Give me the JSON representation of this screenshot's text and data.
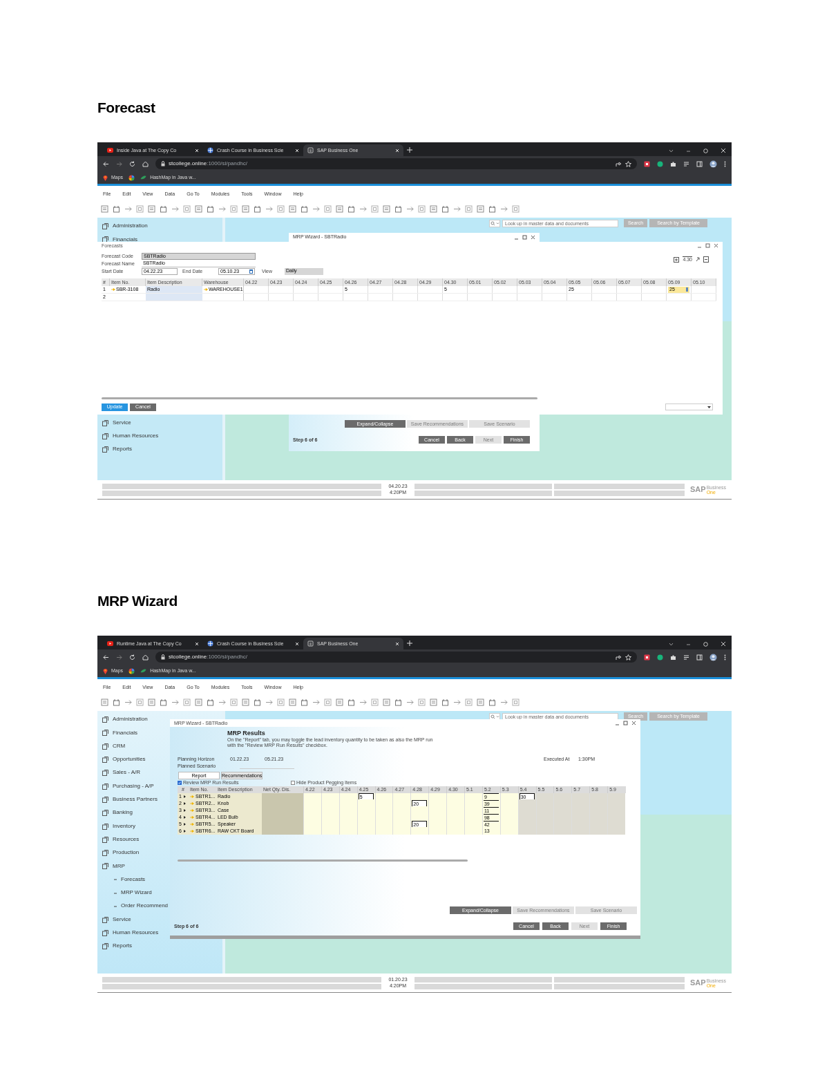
{
  "sections": [
    {
      "heading": "Forecast",
      "kind": "forecast",
      "browser": {
        "tabs": [
          {
            "title": "Inside Java at The Copy Co",
            "selected": false
          },
          {
            "title": "Crash Course in Business Scie",
            "selected": false
          },
          {
            "title": "SAP Business One",
            "selected": true
          }
        ],
        "url_host": "stcollege.online",
        "url_path": ":1000/sl/pandhc/",
        "bookmarks": [
          "Maps",
          "HashMap in Java w..."
        ]
      },
      "menu": [
        "File",
        "Edit",
        "View",
        "Data",
        "Go To",
        "Modules",
        "Tools",
        "Window",
        "Help"
      ],
      "search": {
        "placeholder": "Look up in master data and documents",
        "buttons": [
          "Search",
          "Search by Template"
        ]
      },
      "sidebar_top": [
        {
          "label": "Administration"
        },
        {
          "label": "Financials"
        }
      ],
      "sidebar_bottom": [
        {
          "label": "Service"
        },
        {
          "label": "Human Resources"
        },
        {
          "label": "Reports"
        }
      ],
      "wizard": {
        "title": "MRP Wizard - SBTRadio",
        "top_buttons": [
          {
            "label": "Expand/Collapse",
            "disabled": false
          },
          {
            "label": "Save Recommendations",
            "disabled": true
          },
          {
            "label": "Save Scenario",
            "disabled": true
          }
        ],
        "step": "Step 6 of 6",
        "buttons": [
          {
            "label": "Cancel",
            "disabled": false
          },
          {
            "label": "Back",
            "disabled": false
          },
          {
            "label": "Next",
            "disabled": true
          },
          {
            "label": "Finish",
            "disabled": false
          }
        ]
      },
      "forecast_window": {
        "title": "Forecasts",
        "fields": [
          {
            "label": "Forecast Code",
            "value": "SBTRadio"
          },
          {
            "label": "Forecast Name",
            "value": "SBTRadio"
          }
        ],
        "start_label": "Start Date",
        "start": "04.22.23",
        "end_label": "End Date",
        "end": "05.10.23",
        "view_label": "View",
        "view": "Daily",
        "zoom": "4.30",
        "columns": [
          "#",
          "Item No.",
          "Item Description",
          "Warehouse"
        ],
        "date_columns": [
          "04.22",
          "04.23",
          "04.24",
          "04.25",
          "04.26",
          "04.27",
          "04.28",
          "04.29",
          "04.30",
          "05.01",
          "05.02",
          "05.03",
          "05.04",
          "05.05",
          "05.06",
          "05.07",
          "05.08",
          "05.09",
          "05.10"
        ],
        "rows": [
          {
            "num": "1",
            "item_no": "SBR-3108",
            "description": "Radio",
            "warehouse": "WAREHOUSE1",
            "cells": [
              null,
              null,
              null,
              null,
              {
                "text": "5",
                "selected": false
              },
              null,
              null,
              null,
              {
                "text": "5",
                "selected": false
              },
              null,
              null,
              null,
              null,
              {
                "text": "25",
                "selected": false
              },
              null,
              null,
              null,
              {
                "text": "25",
                "selected": true
              },
              null
            ]
          },
          {
            "num": "2"
          }
        ],
        "buttons": [
          "Update",
          "Cancel"
        ]
      },
      "status_bar": {
        "date": "04.20.23",
        "time": "4:20PM"
      },
      "logo": {
        "brand": "SAP",
        "line1": "Business",
        "line2": "One"
      }
    },
    {
      "heading": "MRP Wizard",
      "kind": "wizard",
      "browser": {
        "tabs": [
          {
            "title": "Runtime Java at The Copy Co",
            "selected": false
          },
          {
            "title": "Crash Course in Business Scie",
            "selected": false
          },
          {
            "title": "SAP Business One",
            "selected": true
          }
        ],
        "url_host": "stcollege.online",
        "url_path": ":1000/sl/pandhc/",
        "bookmarks": [
          "Maps",
          "HashMap in Java w..."
        ]
      },
      "menu": [
        "File",
        "Edit",
        "View",
        "Data",
        "Go To",
        "Modules",
        "Tools",
        "Window",
        "Help"
      ],
      "search": {
        "placeholder": "Look up in master data and documents",
        "buttons": [
          "Search",
          "Search by Template"
        ]
      },
      "sidebar": [
        {
          "label": "Administration"
        },
        {
          "label": "Financials"
        },
        {
          "label": "CRM"
        },
        {
          "label": "Opportunities"
        },
        {
          "label": "Sales - A/R"
        },
        {
          "label": "Purchasing - A/P"
        },
        {
          "label": "Business Partners"
        },
        {
          "label": "Banking"
        },
        {
          "label": "Inventory"
        },
        {
          "label": "Resources"
        },
        {
          "label": "Production"
        },
        {
          "label": "MRP",
          "children": [
            {
              "label": "Forecasts"
            },
            {
              "label": "MRP Wizard"
            },
            {
              "label": "Order Recommend"
            }
          ]
        },
        {
          "label": "Service"
        },
        {
          "label": "Human Resources"
        },
        {
          "label": "Reports"
        }
      ],
      "wizard": {
        "title": "MRP Wizard - SBTRadio",
        "heading": "MRP Results",
        "description": "On the \"Report\" tab, you may toggle the lead inventory quantity to be taken as also the MRP run",
        "description2": "with the \"Review MRP Run Results\" checkbox.",
        "horizon_label": "Planning Horizon",
        "horizon_from": "01.22.23",
        "horizon_to": "05.21.23",
        "scenario_label": "Planned Scenario",
        "executed_label": "Executed At",
        "executed": "1:30PM",
        "tabs": [
          {
            "label": "Report",
            "selected": true
          },
          {
            "label": "Recommendations",
            "selected": false
          }
        ],
        "options": [
          {
            "label": "Review MRP Run Results",
            "checked": true
          },
          {
            "label": "Hide Product Pegging Items",
            "checked": false
          }
        ],
        "columns": [
          "#",
          "Item No.",
          "Item Description",
          "Net Qty. Dis."
        ],
        "date_columns": [
          {
            "label": "4.22",
            "shaded": false
          },
          {
            "label": "4.23",
            "shaded": false
          },
          {
            "label": "4.24",
            "shaded": false
          },
          {
            "label": "4.25",
            "shaded": false
          },
          {
            "label": "4.26",
            "shaded": false
          },
          {
            "label": "4.27",
            "shaded": false
          },
          {
            "label": "4.28",
            "shaded": false
          },
          {
            "label": "4.29",
            "shaded": false
          },
          {
            "label": "4.30",
            "shaded": false
          },
          {
            "label": "5.1",
            "shaded": false
          },
          {
            "label": "5.2",
            "shaded": false
          },
          {
            "label": "5.3",
            "shaded": false
          },
          {
            "label": "5.4",
            "shaded": true
          },
          {
            "label": "5.5",
            "shaded": true
          },
          {
            "label": "5.6",
            "shaded": true
          },
          {
            "label": "5.7",
            "shaded": true
          },
          {
            "label": "5.8",
            "shaded": true
          },
          {
            "label": "5.9",
            "shaded": true
          }
        ],
        "rows": [
          {
            "num": "1",
            "item_no": "SBTR1...",
            "description": "Radio",
            "cells": [
              null,
              null,
              null,
              {
                "text": "5",
                "kind": "boxed"
              },
              null,
              null,
              null,
              null,
              null,
              null,
              {
                "text": "9",
                "kind": "underlined"
              },
              null,
              {
                "text": "30",
                "kind": "boxed"
              },
              null,
              null,
              null,
              null,
              null
            ]
          },
          {
            "num": "2",
            "item_no": "SBTR2...",
            "description": "Knob",
            "cells": [
              null,
              null,
              null,
              null,
              null,
              null,
              {
                "text": "20",
                "kind": "boxed"
              },
              null,
              null,
              null,
              {
                "text": "39",
                "kind": "underlined"
              },
              null,
              null,
              null,
              null,
              null,
              null,
              null
            ]
          },
          {
            "num": "3",
            "item_no": "SBTR3...",
            "description": "Case",
            "cells": [
              null,
              null,
              null,
              null,
              null,
              null,
              null,
              null,
              null,
              null,
              {
                "text": "11",
                "kind": "underlined"
              },
              null,
              null,
              null,
              null,
              null,
              null,
              null
            ]
          },
          {
            "num": "4",
            "item_no": "SBTR4...",
            "description": "LED Bulb",
            "cells": [
              null,
              null,
              null,
              null,
              null,
              null,
              null,
              null,
              null,
              null,
              {
                "text": "98",
                "kind": "underlined"
              },
              null,
              null,
              null,
              null,
              null,
              null,
              null
            ]
          },
          {
            "num": "5",
            "item_no": "SBTR5...",
            "description": "Speaker",
            "cells": [
              null,
              null,
              null,
              null,
              null,
              null,
              {
                "text": "20",
                "kind": "boxed"
              },
              null,
              null,
              null,
              {
                "text": "42",
                "kind": "underlined"
              },
              null,
              null,
              null,
              null,
              null,
              null,
              null
            ]
          },
          {
            "num": "6",
            "item_no": "SBTR6...",
            "description": "RAW CKT Board",
            "cells": [
              null,
              null,
              null,
              null,
              null,
              null,
              null,
              null,
              null,
              null,
              {
                "text": "13",
                "kind": "plain"
              },
              null,
              null,
              null,
              null,
              null,
              null,
              null
            ]
          }
        ],
        "top_buttons": [
          {
            "label": "Expand/Collapse",
            "disabled": false
          },
          {
            "label": "Save Recommendations",
            "disabled": true
          },
          {
            "label": "Save Scenario",
            "disabled": true
          }
        ],
        "step": "Step 6 of 6",
        "buttons": [
          {
            "label": "Cancel",
            "disabled": false
          },
          {
            "label": "Back",
            "disabled": false
          },
          {
            "label": "Next",
            "disabled": true
          },
          {
            "label": "Finish",
            "disabled": false
          }
        ]
      },
      "status_bar": {
        "date": "01.20.23",
        "time": "4:20PM"
      },
      "logo": {
        "brand": "SAP",
        "line1": "Business",
        "line2": "One"
      }
    }
  ]
}
